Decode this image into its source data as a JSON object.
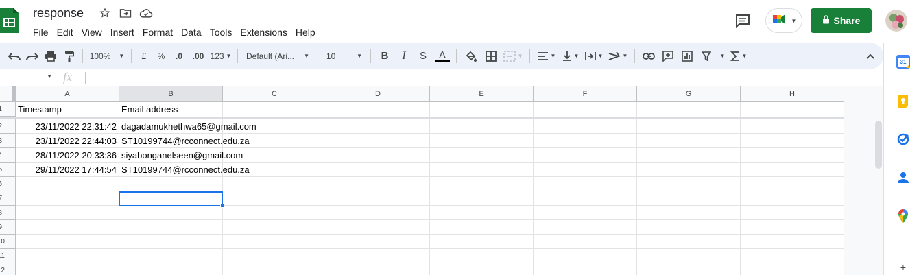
{
  "app": {
    "doc_title": "response",
    "menu": [
      "File",
      "Edit",
      "View",
      "Insert",
      "Format",
      "Data",
      "Tools",
      "Extensions",
      "Help"
    ],
    "share_label": "Share",
    "colors": {
      "share": "#188038",
      "selection": "#1a73e8",
      "toolbar_bg": "#edf2fa"
    }
  },
  "toolbar": {
    "zoom": "100%",
    "currency": "£",
    "percent": "%",
    "decrease_decimal": ".0",
    "increase_decimal": ".00",
    "more_formats": "123",
    "font_family": "Default (Ari...",
    "font_size": "10",
    "bold": "B",
    "italic": "I",
    "strike": "S",
    "text_color": "A"
  },
  "formula": {
    "name_box": "",
    "fx": "fx",
    "content": ""
  },
  "sheet": {
    "columns": [
      "A",
      "B",
      "C",
      "D",
      "E",
      "F",
      "G",
      "H"
    ],
    "row_numbers": [
      "1",
      "2",
      "3",
      "4",
      "5",
      "6",
      "7",
      "8",
      "9",
      "10",
      "11",
      "12"
    ],
    "header": {
      "a": "Timestamp",
      "b": "Email address"
    },
    "rows": [
      {
        "timestamp": "23/11/2022 22:31:42",
        "email": "dagadamukhethwa65@gmail.com"
      },
      {
        "timestamp": "23/11/2022 22:44:03",
        "email": "ST10199744@rcconnect.edu.za"
      },
      {
        "timestamp": "28/11/2022 20:33:36",
        "email": "siyabonganelseen@gmail.com"
      },
      {
        "timestamp": "29/11/2022 17:44:54",
        "email": "ST10199744@rcconnect.edu.za"
      }
    ],
    "selected_cell": "B7"
  },
  "side_panel": {
    "calendar_day": "31",
    "icons": [
      "calendar-icon",
      "keep-icon",
      "tasks-icon",
      "contacts-icon",
      "maps-icon",
      "add-icon"
    ]
  }
}
